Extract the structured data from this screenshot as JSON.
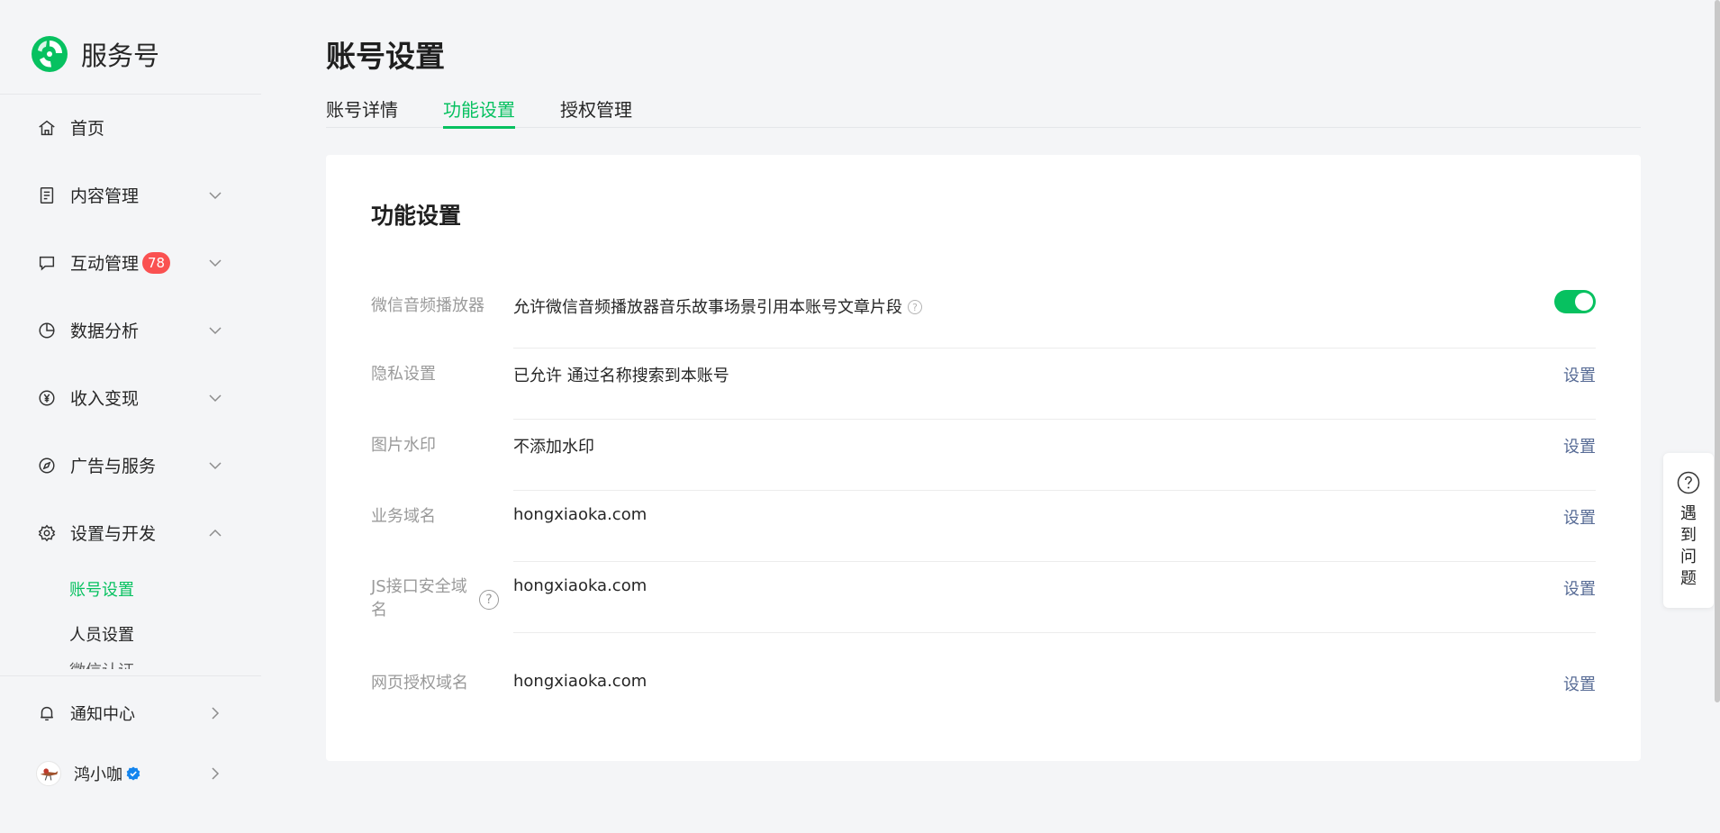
{
  "brand": {
    "name": "服务号",
    "accent": "#07c160"
  },
  "nav": {
    "items": [
      {
        "label": "首页",
        "icon": "home-icon"
      },
      {
        "label": "内容管理",
        "icon": "document-icon"
      },
      {
        "label": "互动管理",
        "icon": "message-icon",
        "badge": "78"
      },
      {
        "label": "数据分析",
        "icon": "pie-chart-icon"
      },
      {
        "label": "收入变现",
        "icon": "yen-icon"
      },
      {
        "label": "广告与服务",
        "icon": "compass-icon"
      },
      {
        "label": "设置与开发",
        "icon": "gear-icon"
      }
    ],
    "sub_items": [
      {
        "label": "账号设置",
        "active": true
      },
      {
        "label": "人员设置",
        "active": false
      }
    ],
    "cut_item": "微信认证"
  },
  "bottom": {
    "notifications": {
      "label": "通知中心",
      "icon": "bell-icon"
    },
    "account": {
      "label": "鸿小咖",
      "icon": "verified-icon"
    }
  },
  "page": {
    "title": "账号设置"
  },
  "tabs": [
    {
      "label": "账号详情",
      "active": false
    },
    {
      "label": "功能设置",
      "active": true
    },
    {
      "label": "授权管理",
      "active": false
    }
  ],
  "card": {
    "title": "功能设置",
    "action_label": "设置",
    "rows": [
      {
        "label": "微信音频播放器",
        "value": "允许微信音频播放器音乐故事场景引用本账号文章片段",
        "toggle_on": true
      },
      {
        "label": "隐私设置",
        "value": "已允许 通过名称搜索到本账号"
      },
      {
        "label": "图片水印",
        "value": "不添加水印"
      },
      {
        "label": "业务域名",
        "value": "hongxiaoka.com"
      },
      {
        "label_line1": "JS接口安全域",
        "label_line2": "名",
        "value": "hongxiaoka.com"
      },
      {
        "label": "网页授权域名",
        "value": "hongxiaoka.com"
      }
    ]
  },
  "help": {
    "label": "遇到问题",
    "icon": "question-circle-icon"
  },
  "colors": {
    "green": "#07c160",
    "link": "#576b95",
    "badge": "#fa5151"
  }
}
